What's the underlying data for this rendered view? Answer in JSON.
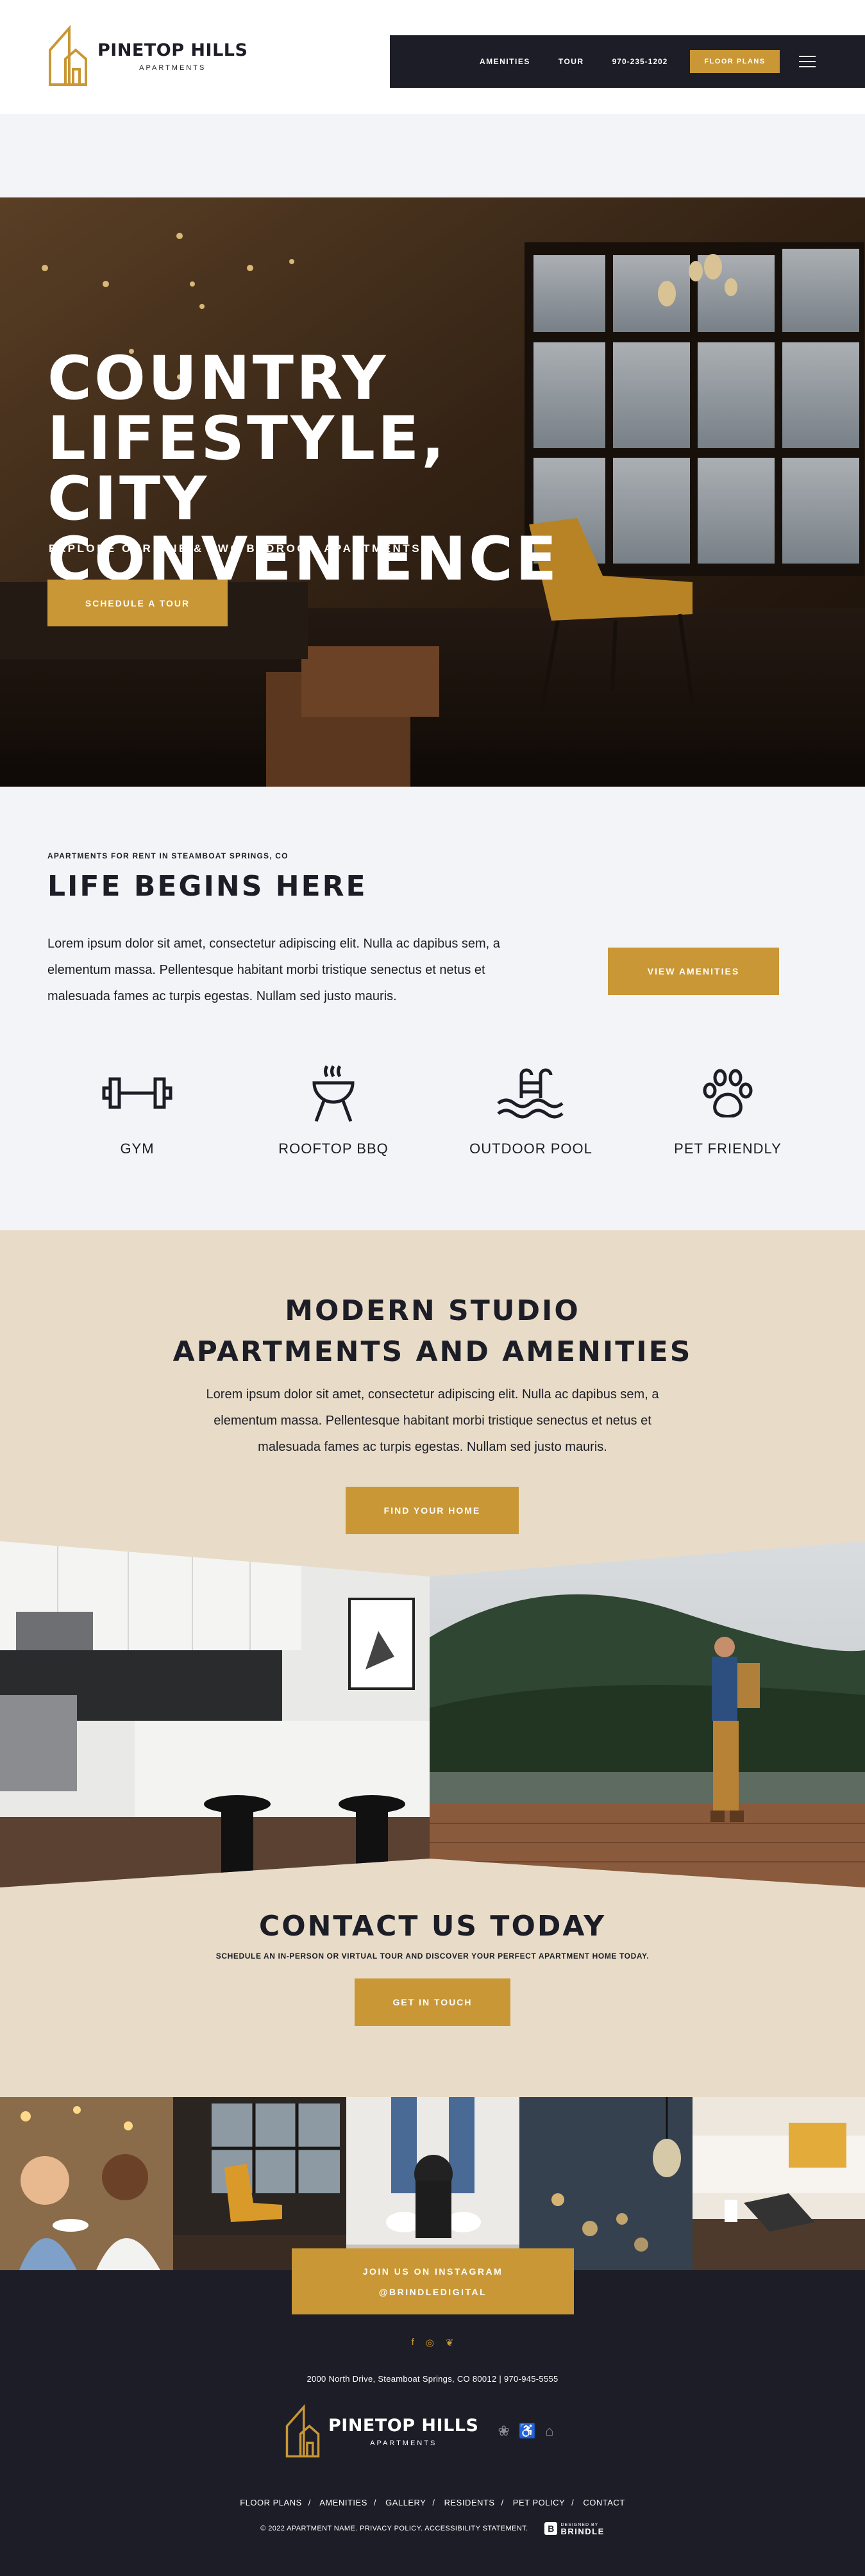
{
  "brand": {
    "name": "PINETOP HILLS",
    "sub": "APARTMENTS",
    "accent": "#c99735",
    "dark": "#1c1d26"
  },
  "nav": {
    "links": [
      "AMENITIES",
      "TOUR"
    ],
    "phone": "970-235-1202",
    "cta": "FLOOR PLANS",
    "menu_icon": "hamburger-icon"
  },
  "hero": {
    "title_lines": [
      "COUNTRY",
      "LIFESTYLE, CITY",
      "CONVENIENCE"
    ],
    "subtitle": "EXPLORE OUR ONE & TWO BEDROOM APARTMENTS",
    "button": "SCHEDULE A TOUR"
  },
  "intro": {
    "eyebrow": "APARTMENTS FOR RENT IN STEAMBOAT SPRINGS, CO",
    "title": "LIFE BEGINS HERE",
    "body": "Lorem ipsum dolor sit amet, consectetur adipiscing elit. Nulla ac dapibus sem, a elementum massa. Pellentesque habitant morbi tristique senectus et netus et malesuada fames ac turpis egestas. Nullam sed justo mauris.",
    "button": "VIEW AMENITIES",
    "amenities": [
      {
        "label": "GYM",
        "icon": "dumbbell-icon"
      },
      {
        "label": "ROOFTOP BBQ",
        "icon": "grill-icon"
      },
      {
        "label": "OUTDOOR POOL",
        "icon": "pool-icon"
      },
      {
        "label": "PET FRIENDLY",
        "icon": "paw-icon"
      }
    ]
  },
  "modern": {
    "title_lines": [
      "MODERN STUDIO",
      "APARTMENTS AND AMENITIES"
    ],
    "body": "Lorem ipsum dolor sit amet, consectetur adipiscing elit. Nulla ac dapibus sem, a elementum massa. Pellentesque habitant morbi tristique senectus et netus et malesuada fames ac turpis egestas. Nullam sed justo mauris.",
    "button": "FIND YOUR HOME"
  },
  "contact": {
    "title": "CONTACT US TODAY",
    "subtitle": "SCHEDULE AN IN-PERSON OR VIRTUAL TOUR AND DISCOVER YOUR PERFECT APARTMENT HOME TODAY.",
    "button": "GET IN TOUCH"
  },
  "instagram": {
    "line1": "JOIN US ON INSTAGRAM",
    "line2": "@BRINDLEDIGITAL"
  },
  "footer": {
    "social": [
      "facebook-icon",
      "instagram-icon",
      "twitter-icon"
    ],
    "address": "2000 North Drive, Steamboat Springs, CO 80012  |  970-945-5555",
    "links": [
      "FLOOR PLANS",
      "AMENITIES",
      "GALLERY",
      "RESIDENTS",
      "PET POLICY",
      "CONTACT"
    ],
    "copyright": "© 2022 APARTMENT NAME. PRIVACY POLICY.  ACCESSIBILITY STATEMENT.",
    "designed_by": "DESIGNED BY",
    "designer": "BRINDLE"
  }
}
